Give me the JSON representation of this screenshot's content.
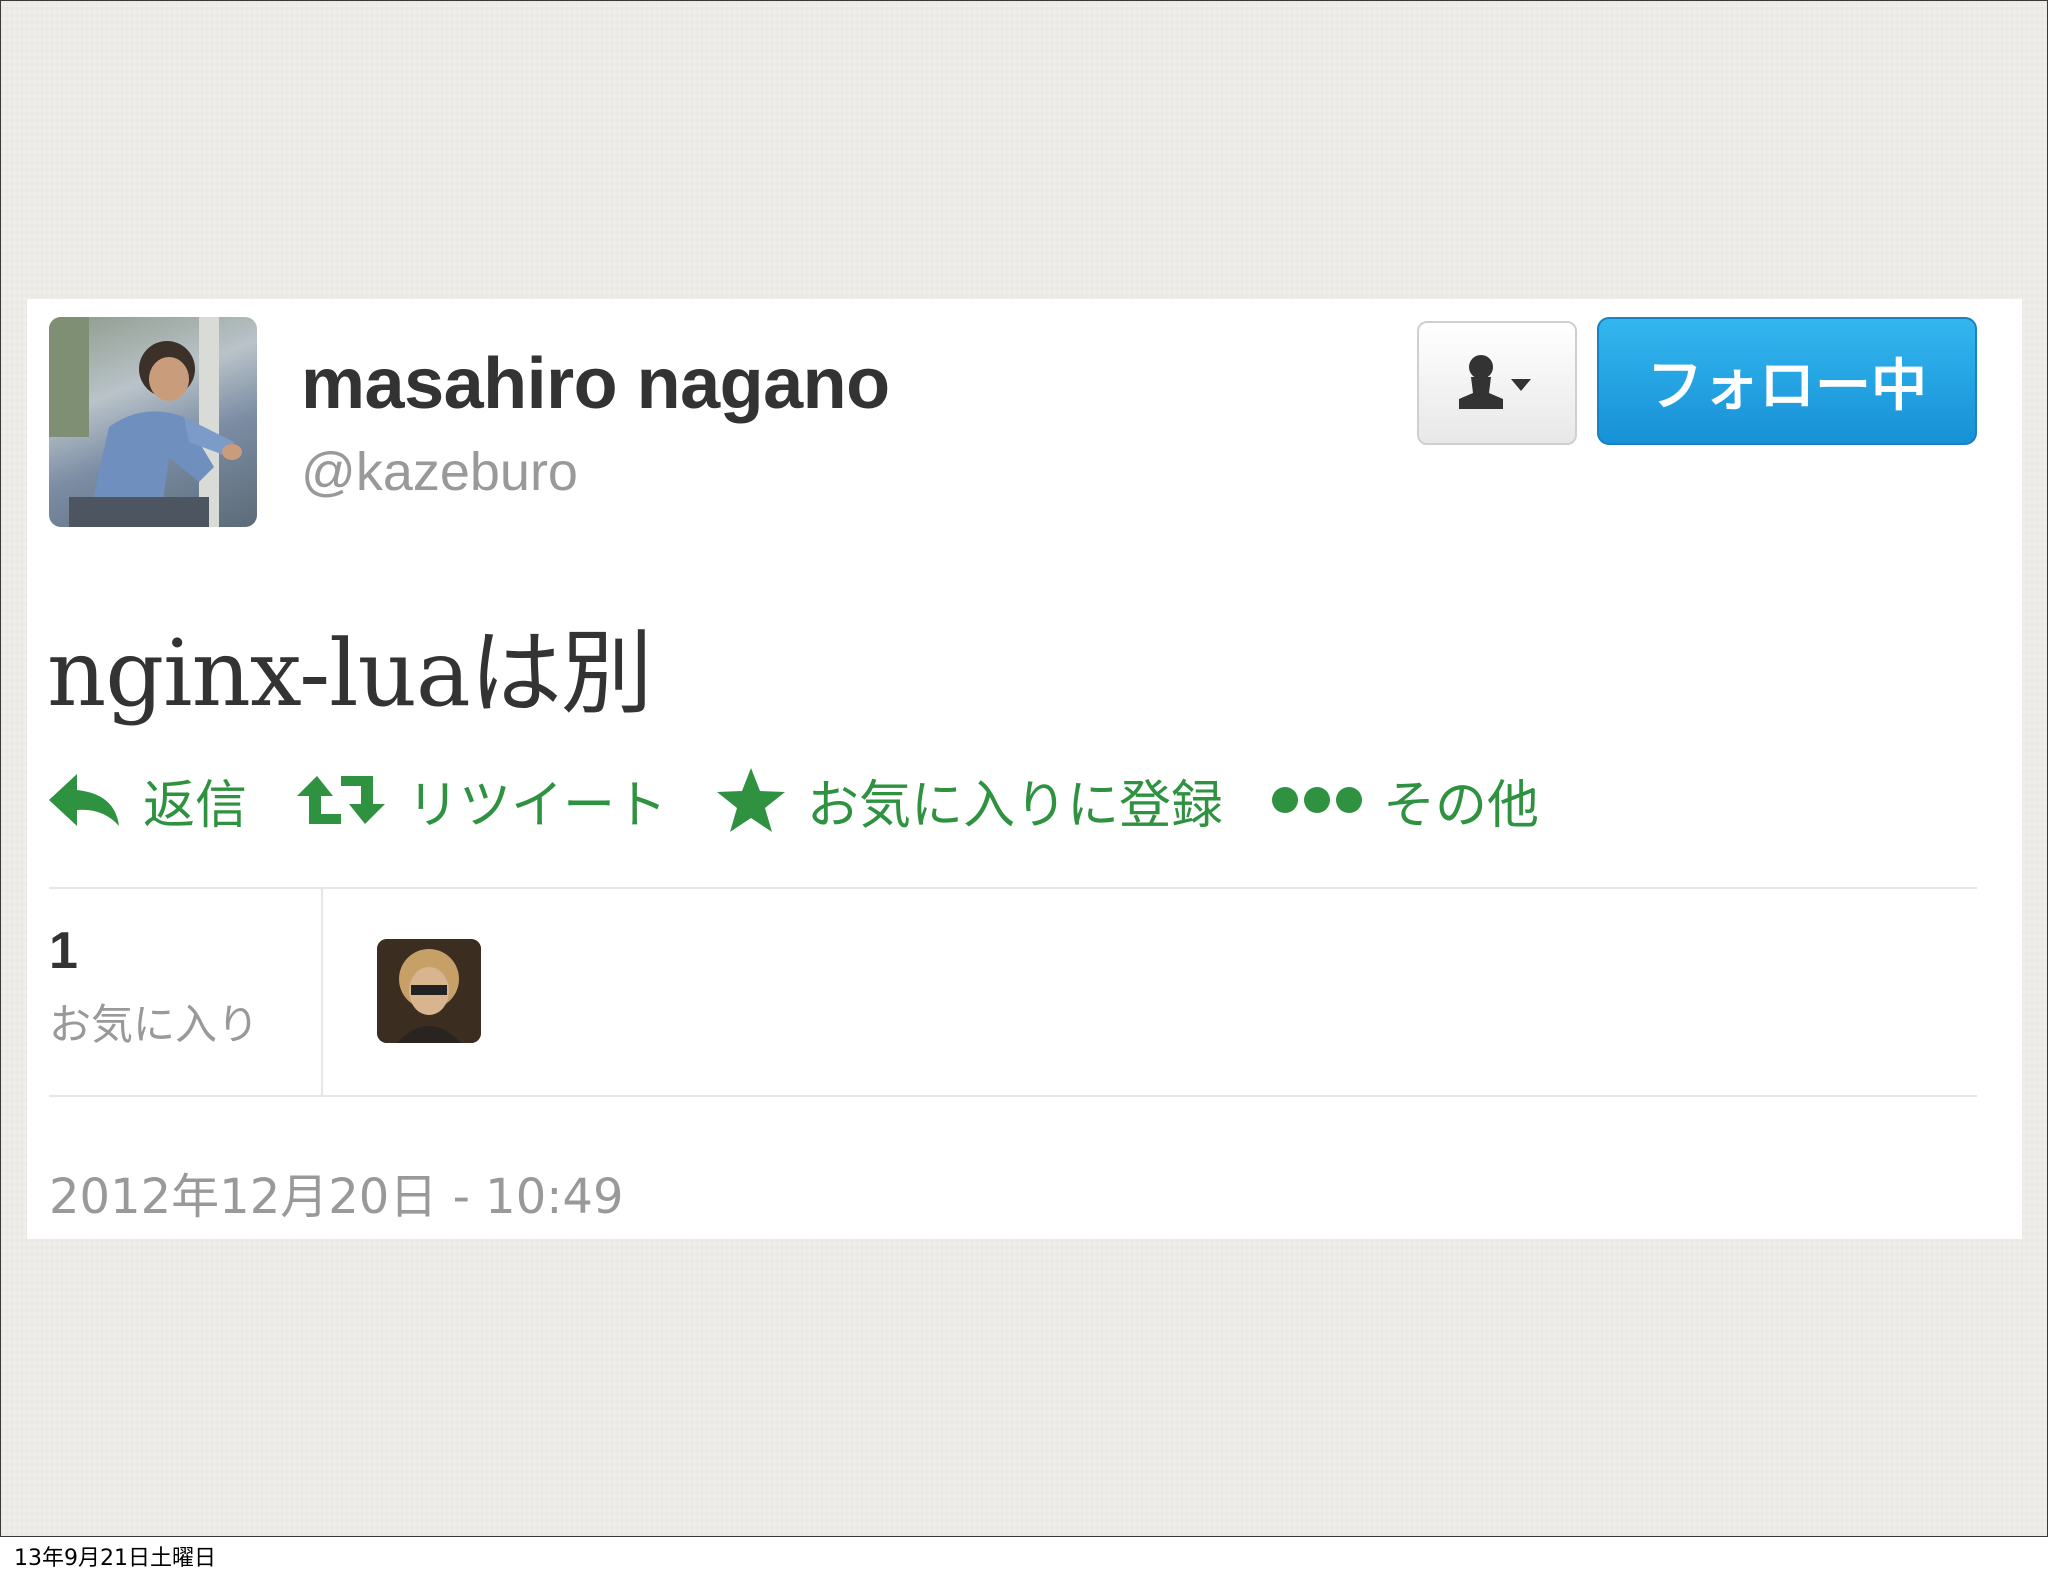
{
  "tweet": {
    "display_name": "masahiro nagano",
    "handle": "@kazeburo",
    "follow_button_label": "フォロー中",
    "text": "nginx-luaは別",
    "actions": [
      {
        "label": "返信",
        "icon": "reply-icon"
      },
      {
        "label": "リツイート",
        "icon": "retweet-icon"
      },
      {
        "label": "お気に入りに登録",
        "icon": "star-icon"
      },
      {
        "label": "その他",
        "icon": "more-dots-icon"
      }
    ],
    "favorites_count": "1",
    "favorites_label": "お気に入り",
    "timestamp": "2012年12月20日 - 10:49"
  },
  "colors": {
    "action_green": "#2e9240",
    "follow_blue": "#1791d6",
    "slide_background": "#efeeea"
  },
  "slide_footer": "13年9月21日土曜日"
}
